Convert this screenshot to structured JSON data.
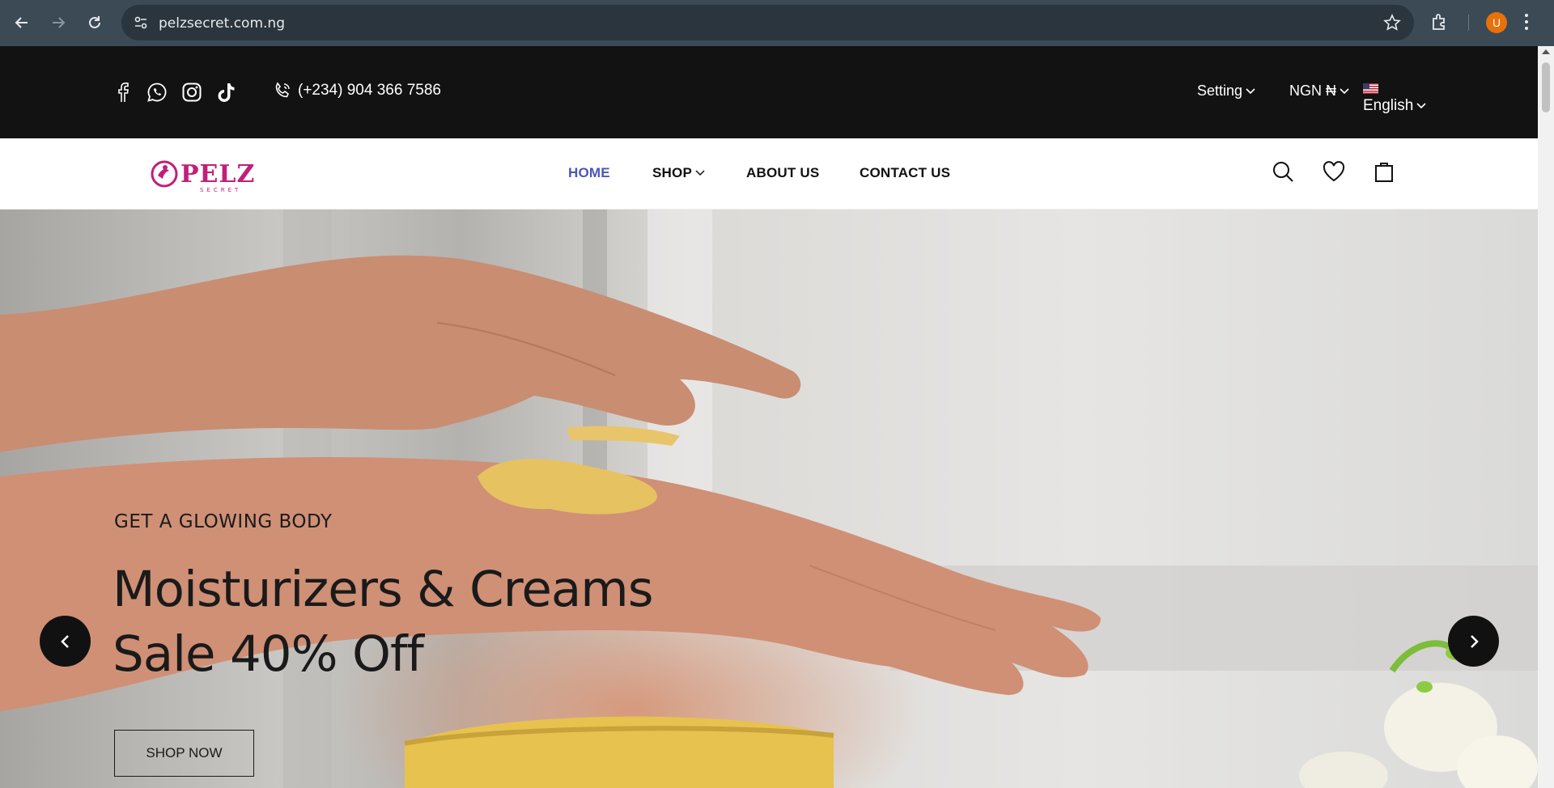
{
  "browser": {
    "url": "pelzsecret.com.ng",
    "profile_initial": "U",
    "profile_color": "#e8710a",
    "icons": [
      "back-arrow-icon",
      "forward-arrow-icon",
      "reload-icon",
      "site-settings-icon",
      "star-icon",
      "extensions-icon",
      "more-menu-icon"
    ]
  },
  "topbar": {
    "social": [
      "facebook-icon",
      "whatsapp-icon",
      "instagram-icon",
      "tiktok-icon"
    ],
    "phone": "(+234) 904 366 7586",
    "setting_label": "Setting",
    "currency_label": "NGN ₦",
    "language_label": "English"
  },
  "nav": {
    "logo_text": "PELZ",
    "logo_sub": "SECRET",
    "items": [
      {
        "label": "HOME",
        "active": true
      },
      {
        "label": "SHOP",
        "active": false,
        "dropdown": true
      },
      {
        "label": "ABOUT US",
        "active": false
      },
      {
        "label": "CONTACT US",
        "active": false
      }
    ],
    "accent_color": "#4c56b8"
  },
  "hero": {
    "subtitle": "GET A GLOWING BODY",
    "title_line1": "Moisturizers & Creams",
    "title_line2": "Sale 40% Off",
    "button_label": "SHOP NOW"
  }
}
